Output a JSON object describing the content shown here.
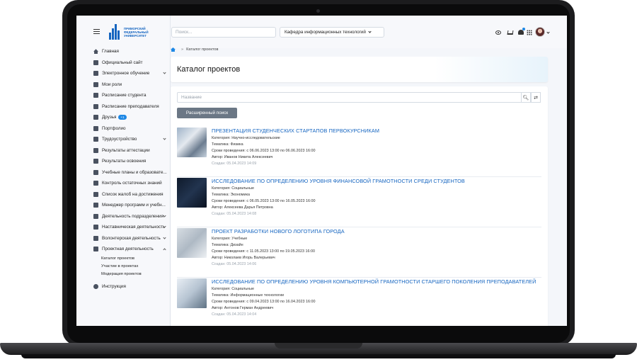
{
  "university": {
    "logo_text": "ПРИМОРСКИЙ ФЕДЕРАЛЬНЫЙ УНИВЕРСИТЕТ"
  },
  "sidebar": {
    "items": [
      {
        "label": "Главная",
        "icon": "home-icon",
        "chevron": false
      },
      {
        "label": "Официальный сайт",
        "icon": "globe-icon",
        "chevron": false
      },
      {
        "label": "Электронное обучение",
        "icon": "graduation-cap-icon",
        "chevron": true
      },
      {
        "label": "Мои роли",
        "icon": "user-icon",
        "chevron": false
      },
      {
        "label": "Расписание студента",
        "icon": "calendar-icon",
        "chevron": false
      },
      {
        "label": "Расписание преподавателя",
        "icon": "calendar-icon",
        "chevron": false
      },
      {
        "label": "Друзья",
        "icon": "users-icon",
        "chevron": false,
        "badge": "+1"
      },
      {
        "label": "Портфолио",
        "icon": "folder-icon",
        "chevron": false
      },
      {
        "label": "Трудоустройство",
        "icon": "briefcase-icon",
        "chevron": true
      },
      {
        "label": "Результаты аттестации",
        "icon": "list-icon",
        "chevron": false
      },
      {
        "label": "Результаты освоения",
        "icon": "list-icon",
        "chevron": false
      },
      {
        "label": "Учебные планы и образовате...",
        "icon": "book-icon",
        "chevron": false
      },
      {
        "label": "Контроль остаточных знаний",
        "icon": "check-icon",
        "chevron": false
      },
      {
        "label": "Список жалоб на достижения",
        "icon": "warning-icon",
        "chevron": false
      },
      {
        "label": "Менеджер программ и учебн...",
        "icon": "edit-icon",
        "chevron": false
      },
      {
        "label": "Деятельность подразделения",
        "icon": "org-icon",
        "chevron": true
      },
      {
        "label": "Наставническая деятельность",
        "icon": "list-icon",
        "chevron": true
      },
      {
        "label": "Волонтерская деятельность",
        "icon": "heart-icon",
        "chevron": true
      },
      {
        "label": "Проектная деятельность",
        "icon": "rocket-icon",
        "chevron": true,
        "expanded": true
      }
    ],
    "subitems": [
      "Каталог проектов",
      "Участие в проектах",
      "Модерация проектов"
    ],
    "help": {
      "label": "Инструкция",
      "icon": "question-icon"
    }
  },
  "header": {
    "search_placeholder": "Поиск...",
    "department": "Кафедра информационных технологий"
  },
  "breadcrumb": {
    "current": "Каталог проектов"
  },
  "page": {
    "title": "Каталог проектов",
    "name_placeholder": "Название",
    "advanced_search": "Расширенный поиск"
  },
  "projects": [
    {
      "title": "ПРЕЗЕНТАЦИЯ СТУДЕНЧЕСКИХ СТАРТАПОВ ПЕРВОКУРСНИКАМ",
      "category": "Категория: Научно-исследовательские",
      "topic": "Тематика: Физика",
      "dates": "Сроки проведения: с 06.06.2023 13:00 по 06.06.2023 16:00",
      "author": "Автор: Иванов Никита Алексеевич",
      "created": "Создан: 05.04.2023 14:09"
    },
    {
      "title": "ИССЛЕДОВАНИЕ ПО ОПРЕДЕЛЕНИЮ УРОВНЯ ФИНАНСОВОЙ ГРАМОТНОСТИ СРЕДИ СТУДЕНТОВ",
      "category": "Категория: Социальные",
      "topic": "Тематика: Экономика",
      "dates": "Сроки проведения: с 06.05.2023 13:00 по 16.05.2023 16:00",
      "author": "Автор: Алексеева Дарья Петровна",
      "created": "Создан: 05.04.2023 14:08"
    },
    {
      "title": "ПРОЕКТ РАЗРАБОТКИ НОВОГО ЛОГОТИПА ГОРОДА",
      "category": "Категория: Учебные",
      "topic": "Тематика: Дизайн",
      "dates": "Сроки проведения: с 11.05.2023 13:00 по 19.05.2023 16:00",
      "author": "Автор: Николаев Игорь Валерьевич",
      "created": "Создан: 05.04.2023 14:06"
    },
    {
      "title": "ИССЛЕДОВАНИЕ ПО ОПРЕДЕЛЕНИЮ УРОВНЯ КОМПЬЮТЕРНОЙ ГРАМОТНОСТИ СТАРШЕГО ПОКОЛЕНИЯ ПРЕПОДАВАТЕЛЕЙ",
      "category": "Категория: Социальные",
      "topic": "Тематика: Информационные технологии",
      "dates": "Сроки проведения: с 09.04.2023 13:00 по 16.04.2023 16:00",
      "author": "Автор: Антонов Герман Андреевич",
      "created": "Создан: 05.04.2023 14:04"
    }
  ],
  "colors": {
    "accent": "#1565c0",
    "badge": "#1e88e5",
    "button": "#6b7785"
  }
}
